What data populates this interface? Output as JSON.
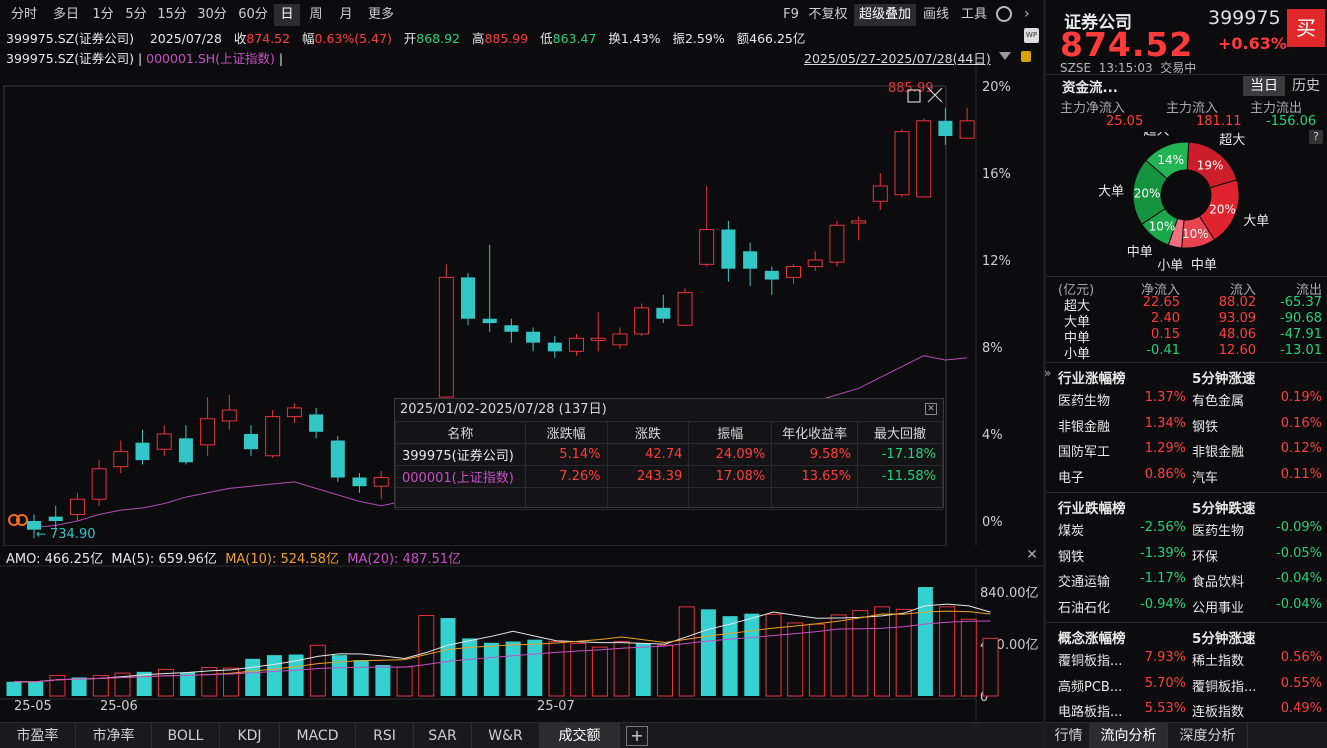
{
  "toolbar": {
    "periods": [
      "分时",
      "多日",
      "1分",
      "5分",
      "15分",
      "30分",
      "60分",
      "日",
      "周",
      "月",
      "更多"
    ],
    "selected_period": "日",
    "right_items": [
      "F9",
      "不复权",
      "超级叠加",
      "画线",
      "工具"
    ],
    "wp_badge": "WP"
  },
  "info": {
    "code": "399975.SZ(证券公司)",
    "date": "2025/07/28",
    "close_label": "收",
    "close": "874.52",
    "range_label": "幅",
    "range": "0.63%(5.47)",
    "open_label": "开",
    "open": "868.92",
    "high_label": "高",
    "high": "885.99",
    "low_label": "低",
    "low": "863.47",
    "turnover_label": "换",
    "turnover": "1.43%",
    "amp_label": "振",
    "amp": "2.59%",
    "amount_label": "额",
    "amount": "466.25亿"
  },
  "compare": {
    "main": "399975.SZ(证券公司)",
    "sep": "|",
    "overlay": "000001.SH(上证指数)",
    "sep2": "|",
    "date_range": "2025/05/27-2025/07/28(44日)"
  },
  "chart_data": [
    {
      "type": "candlestick",
      "title": "",
      "y_axis_labels": [
        "20%",
        "16%",
        "12%",
        "8%",
        "4%",
        "0%"
      ],
      "ylim_pct": [
        0,
        20
      ],
      "base_value": 734.9,
      "max_label": "885.99",
      "min_label": "734.90",
      "candles": [
        {
          "o": 0.0,
          "c": -0.4,
          "h": 0.3,
          "l": -0.8,
          "up": false
        },
        {
          "o": 0.2,
          "c": 0.0,
          "h": 0.7,
          "l": -0.4,
          "up": false
        },
        {
          "o": 0.3,
          "c": 1.0,
          "h": 1.3,
          "l": 0.0,
          "up": true
        },
        {
          "o": 1.0,
          "c": 2.4,
          "h": 2.8,
          "l": 0.7,
          "up": true
        },
        {
          "o": 2.5,
          "c": 3.2,
          "h": 3.7,
          "l": 2.2,
          "up": true
        },
        {
          "o": 2.8,
          "c": 3.6,
          "h": 4.2,
          "l": 2.6,
          "up": false
        },
        {
          "o": 3.3,
          "c": 4.0,
          "h": 4.4,
          "l": 3.0,
          "up": true
        },
        {
          "o": 3.8,
          "c": 2.7,
          "h": 4.4,
          "l": 2.6,
          "up": false
        },
        {
          "o": 3.5,
          "c": 4.7,
          "h": 5.7,
          "l": 3.0,
          "up": true
        },
        {
          "o": 4.6,
          "c": 5.1,
          "h": 5.8,
          "l": 4.2,
          "up": true
        },
        {
          "o": 4.0,
          "c": 3.3,
          "h": 4.4,
          "l": 3.0,
          "up": false
        },
        {
          "o": 3.0,
          "c": 4.8,
          "h": 5.1,
          "l": 2.9,
          "up": true
        },
        {
          "o": 4.8,
          "c": 5.2,
          "h": 5.4,
          "l": 4.5,
          "up": true
        },
        {
          "o": 4.9,
          "c": 4.1,
          "h": 5.2,
          "l": 3.8,
          "up": false
        },
        {
          "o": 3.7,
          "c": 2.0,
          "h": 3.9,
          "l": 1.8,
          "up": false
        },
        {
          "o": 2.0,
          "c": 1.6,
          "h": 2.2,
          "l": 1.3,
          "up": false
        },
        {
          "o": 1.6,
          "c": 2.0,
          "h": 2.3,
          "l": 1.0,
          "up": true
        },
        {
          "o": 2.1,
          "c": 2.3,
          "h": 2.7,
          "l": 1.8,
          "up": true
        },
        {
          "o": 2.5,
          "c": 3.2,
          "h": 3.6,
          "l": 2.3,
          "up": true
        },
        {
          "o": 5.7,
          "c": 11.2,
          "h": 11.8,
          "l": 5.6,
          "up": true
        },
        {
          "o": 11.2,
          "c": 9.3,
          "h": 11.4,
          "l": 9.0,
          "up": false
        },
        {
          "o": 9.3,
          "c": 9.1,
          "h": 12.7,
          "l": 8.7,
          "up": false
        },
        {
          "o": 9.0,
          "c": 8.7,
          "h": 9.3,
          "l": 8.2,
          "up": false
        },
        {
          "o": 8.7,
          "c": 8.2,
          "h": 8.9,
          "l": 7.8,
          "up": false
        },
        {
          "o": 8.2,
          "c": 7.8,
          "h": 8.5,
          "l": 7.5,
          "up": false
        },
        {
          "o": 7.8,
          "c": 8.4,
          "h": 8.6,
          "l": 7.6,
          "up": true
        },
        {
          "o": 8.3,
          "c": 8.4,
          "h": 9.6,
          "l": 7.8,
          "up": true
        },
        {
          "o": 8.1,
          "c": 8.6,
          "h": 8.9,
          "l": 7.9,
          "up": true
        },
        {
          "o": 8.6,
          "c": 9.8,
          "h": 10.0,
          "l": 8.5,
          "up": true
        },
        {
          "o": 9.8,
          "c": 9.3,
          "h": 10.4,
          "l": 9.1,
          "up": false
        },
        {
          "o": 9.0,
          "c": 10.5,
          "h": 10.7,
          "l": 9.0,
          "up": true
        },
        {
          "o": 11.8,
          "c": 13.4,
          "h": 15.4,
          "l": 11.7,
          "up": true
        },
        {
          "o": 13.4,
          "c": 11.6,
          "h": 13.8,
          "l": 11.0,
          "up": false
        },
        {
          "o": 12.4,
          "c": 11.6,
          "h": 12.8,
          "l": 10.8,
          "up": false
        },
        {
          "o": 11.5,
          "c": 11.1,
          "h": 11.7,
          "l": 10.4,
          "up": false
        },
        {
          "o": 11.2,
          "c": 11.7,
          "h": 11.8,
          "l": 10.9,
          "up": true
        },
        {
          "o": 11.7,
          "c": 12.0,
          "h": 12.4,
          "l": 11.5,
          "up": true
        },
        {
          "o": 11.9,
          "c": 13.6,
          "h": 13.8,
          "l": 11.7,
          "up": true
        },
        {
          "o": 13.8,
          "c": 13.7,
          "h": 14.0,
          "l": 12.9,
          "up": true
        },
        {
          "o": 14.7,
          "c": 15.4,
          "h": 16.0,
          "l": 14.3,
          "up": true
        },
        {
          "o": 15.0,
          "c": 17.9,
          "h": 18.0,
          "l": 14.9,
          "up": true
        },
        {
          "o": 14.9,
          "c": 18.4,
          "h": 18.5,
          "l": 14.9,
          "up": true
        },
        {
          "o": 18.4,
          "c": 17.7,
          "h": 19.0,
          "l": 17.3,
          "up": false
        },
        {
          "o": 17.6,
          "c": 18.4,
          "h": 19.0,
          "l": 17.6,
          "up": true
        }
      ],
      "overlay_series": {
        "name": "000001.SH(上证指数)",
        "color": "#b24bb4",
        "values_pct": [
          -0.3,
          -0.2,
          0.0,
          0.3,
          0.5,
          0.6,
          0.8,
          1.1,
          1.3,
          1.5,
          1.6,
          1.7,
          1.8,
          1.5,
          1.2,
          0.9,
          0.7,
          0.9,
          1.2,
          1.4,
          1.6,
          1.8,
          2.0,
          2.3,
          2.5,
          2.9,
          3.1,
          3.4,
          3.6,
          3.7,
          3.9,
          4.2,
          4.6,
          5.0,
          5.4,
          5.6,
          5.5,
          5.8,
          6.1,
          6.6,
          7.1,
          7.6,
          7.4,
          7.5
        ]
      }
    },
    {
      "type": "bar",
      "title": "",
      "amo_label": "AMO: 466.25亿",
      "ma5_label": "MA(5): 659.96亿",
      "ma10_label": "MA(10): 524.58亿",
      "ma20_label": "MA(20): 487.51亿",
      "y_axis_labels": [
        "840.00亿",
        "420.00亿",
        "0"
      ],
      "ylim": [
        0,
        1050
      ],
      "values": [
        115,
        115,
        165,
        150,
        165,
        185,
        195,
        215,
        190,
        230,
        225,
        300,
        330,
        335,
        410,
        330,
        290,
        250,
        235,
        650,
        630,
        465,
        430,
        440,
        455,
        440,
        425,
        395,
        440,
        425,
        410,
        720,
        700,
        645,
        665,
        660,
        590,
        580,
        655,
        690,
        720,
        700,
        880,
        720,
        620,
        466
      ],
      "up": [
        false,
        false,
        true,
        false,
        true,
        true,
        false,
        true,
        false,
        true,
        true,
        false,
        false,
        false,
        true,
        false,
        false,
        false,
        true,
        true,
        false,
        false,
        false,
        false,
        false,
        true,
        true,
        true,
        true,
        false,
        true,
        true,
        false,
        false,
        false,
        true,
        true,
        true,
        true,
        true,
        true,
        true,
        false,
        true,
        true,
        true
      ]
    }
  ],
  "date_axis": [
    "25-05",
    "25-06",
    "25-07"
  ],
  "perf_table": {
    "header": "2025/01/02-2025/07/28 (137日)",
    "columns": [
      "名称",
      "涨跌幅",
      "涨跌",
      "振幅",
      "年化收益率",
      "最大回撤"
    ],
    "rows": [
      {
        "name": "399975(证券公司)",
        "pct": "5.14%",
        "chg": "42.74",
        "amp": "24.09%",
        "annual": "9.58%",
        "dd": "-17.18%"
      },
      {
        "name": "000001(上证指数)",
        "pct": "7.26%",
        "chg": "243.39",
        "amp": "17.08%",
        "annual": "13.65%",
        "dd": "-11.58%"
      }
    ]
  },
  "bottom_tabs": [
    "市盈率",
    "市净率",
    "BOLL",
    "KDJ",
    "MACD",
    "RSI",
    "SAR",
    "W&R",
    "成交额"
  ],
  "bottom_selected": "成交额",
  "panel": {
    "name": "证券公司",
    "code": "399975",
    "price": "874.52",
    "change": "+0.63%",
    "buy": "买",
    "exchange": "SZSE",
    "time": "13:15:03",
    "status": "交易中",
    "flow_title": "资金流...",
    "tab_today": "当日",
    "tab_history": "历史",
    "flow_heads": [
      "主力净流入",
      "主力流入",
      "主力流出"
    ],
    "flow_vals": [
      "25.05",
      "181.11",
      "-156.06"
    ],
    "help": "?",
    "pie": [
      {
        "label": "超大",
        "pct": "19%",
        "value": 19,
        "color": "#cc1e2a"
      },
      {
        "label": "大单",
        "pct": "20%",
        "value": 20,
        "color": "#e0242f"
      },
      {
        "label": "中单",
        "pct": "10%",
        "value": 10,
        "color": "#e84450"
      },
      {
        "label": "小单",
        "pct": "",
        "value": 4,
        "color": "#f07080"
      },
      {
        "label": "中单",
        "pct": "10%",
        "value": 10,
        "color": "#1aa84a"
      },
      {
        "label": "大单",
        "pct": "20%",
        "value": 20,
        "color": "#15933f"
      },
      {
        "label": "超大",
        "pct": "14%",
        "value": 14,
        "color": "#21b653"
      }
    ],
    "flow_table": {
      "heads": [
        "(亿元)",
        "净流入",
        "流入",
        "流出"
      ],
      "rows": [
        [
          "超大",
          "22.65",
          "88.02",
          "-65.37"
        ],
        [
          "大单",
          "2.40",
          "93.09",
          "-90.68"
        ],
        [
          "中单",
          "0.15",
          "48.06",
          "-47.91"
        ],
        [
          "小单",
          "-0.41",
          "12.60",
          "-13.01"
        ]
      ]
    },
    "ind_up_title": "行业涨幅榜",
    "spd_up_title": "5分钟涨速",
    "ind_up": [
      [
        "医药生物",
        "1.37%"
      ],
      [
        "非银金融",
        "1.34%"
      ],
      [
        "国防军工",
        "1.29%"
      ],
      [
        "电子",
        "0.86%"
      ]
    ],
    "spd_up": [
      [
        "有色金属",
        "0.19%"
      ],
      [
        "钢铁",
        "0.16%"
      ],
      [
        "非银金融",
        "0.12%"
      ],
      [
        "汽车",
        "0.11%"
      ]
    ],
    "ind_dn_title": "行业跌幅榜",
    "spd_dn_title": "5分钟跌速",
    "ind_dn": [
      [
        "煤炭",
        "-2.56%"
      ],
      [
        "钢铁",
        "-1.39%"
      ],
      [
        "交通运输",
        "-1.17%"
      ],
      [
        "石油石化",
        "-0.94%"
      ]
    ],
    "spd_dn": [
      [
        "医药生物",
        "-0.09%"
      ],
      [
        "环保",
        "-0.05%"
      ],
      [
        "食品饮料",
        "-0.04%"
      ],
      [
        "公用事业",
        "-0.04%"
      ]
    ],
    "con_up_title": "概念涨幅榜",
    "con_spd_title": "5分钟涨速",
    "con_up": [
      [
        "覆铜板指...",
        "7.93%"
      ],
      [
        "高频PCB...",
        "5.70%"
      ],
      [
        "电路板指...",
        "5.53%"
      ]
    ],
    "con_spd": [
      [
        "稀土指数",
        "0.56%"
      ],
      [
        "覆铜板指...",
        "0.55%"
      ],
      [
        "连板指数",
        "0.49%"
      ]
    ],
    "bottom_tabs": [
      "行情",
      "流向分析",
      "深度分析"
    ],
    "bottom_selected": "流向分析"
  }
}
